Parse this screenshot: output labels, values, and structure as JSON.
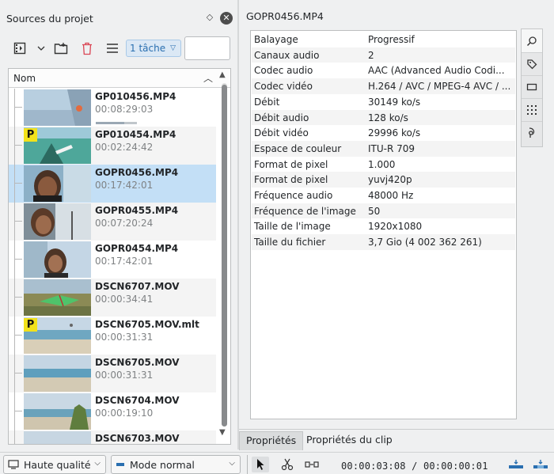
{
  "bin_panel": {
    "title": "Sources du projet",
    "tasks_label": "1 tâche",
    "search_value": "",
    "column_header": "Nom",
    "clips": [
      {
        "name": "GP010456.MP4",
        "duration": "00:08:29:03",
        "proxy": false,
        "thumb": "sky"
      },
      {
        "name": "GP010454.MP4",
        "duration": "00:02:24:42",
        "proxy": true,
        "thumb": "sea-green"
      },
      {
        "name": "GOPR0456.MP4",
        "duration": "00:17:42:01",
        "proxy": false,
        "thumb": "face-dark",
        "selected": true
      },
      {
        "name": "GOPR0455.MP4",
        "duration": "00:07:20:24",
        "proxy": false,
        "thumb": "face-light"
      },
      {
        "name": "GOPR0454.MP4",
        "duration": "00:17:42:01",
        "proxy": false,
        "thumb": "face-sky"
      },
      {
        "name": "DSCN6707.MOV",
        "duration": "00:00:34:41",
        "proxy": false,
        "thumb": "kite-grass"
      },
      {
        "name": "DSCN6705.MOV.mlt",
        "duration": "00:00:31:31",
        "proxy": true,
        "thumb": "beach"
      },
      {
        "name": "DSCN6705.MOV",
        "duration": "00:00:31:31",
        "proxy": false,
        "thumb": "beach2"
      },
      {
        "name": "DSCN6704.MOV",
        "duration": "00:00:19:10",
        "proxy": false,
        "thumb": "beach-tree"
      },
      {
        "name": "DSCN6703.MOV",
        "duration": "",
        "proxy": false,
        "thumb": "beach3"
      }
    ]
  },
  "properties_panel": {
    "clip_title": "GOPR0456.MP4",
    "rows": [
      {
        "key": "Balayage",
        "value": "Progressif"
      },
      {
        "key": "Canaux audio",
        "value": "2"
      },
      {
        "key": "Codec audio",
        "value": "AAC (Advanced Audio Codi..."
      },
      {
        "key": "Codec vidéo",
        "value": "H.264 / AVC / MPEG-4 AVC / ..."
      },
      {
        "key": "Débit",
        "value": "30149 ko/s"
      },
      {
        "key": "Débit audio",
        "value": "128 ko/s"
      },
      {
        "key": "Débit vidéo",
        "value": "29996 ko/s"
      },
      {
        "key": "Espace de couleur",
        "value": "ITU-R 709"
      },
      {
        "key": "Format de pixel",
        "value": "1.000"
      },
      {
        "key": "Format de pixel",
        "value": "yuvj420p"
      },
      {
        "key": "Fréquence audio",
        "value": "48000 Hz"
      },
      {
        "key": "Fréquence de l'image",
        "value": "50"
      },
      {
        "key": "Taille de l'image",
        "value": "1920x1080"
      },
      {
        "key": "Taille du fichier",
        "value": "3,7 Gio (4 002 362 261)"
      }
    ],
    "tabs": [
      {
        "label": "Propriétés",
        "active": true
      },
      {
        "label": "Propriétés du clip",
        "active": false
      }
    ]
  },
  "bottom_bar": {
    "quality": "Haute qualité",
    "mode": "Mode normal",
    "timecode": "00:00:03:08 / 00:00:00:01"
  },
  "colors": {
    "selection": "#c3dff6",
    "proxy_badge": "#f2e21b",
    "accent": "#2a6fb0"
  }
}
